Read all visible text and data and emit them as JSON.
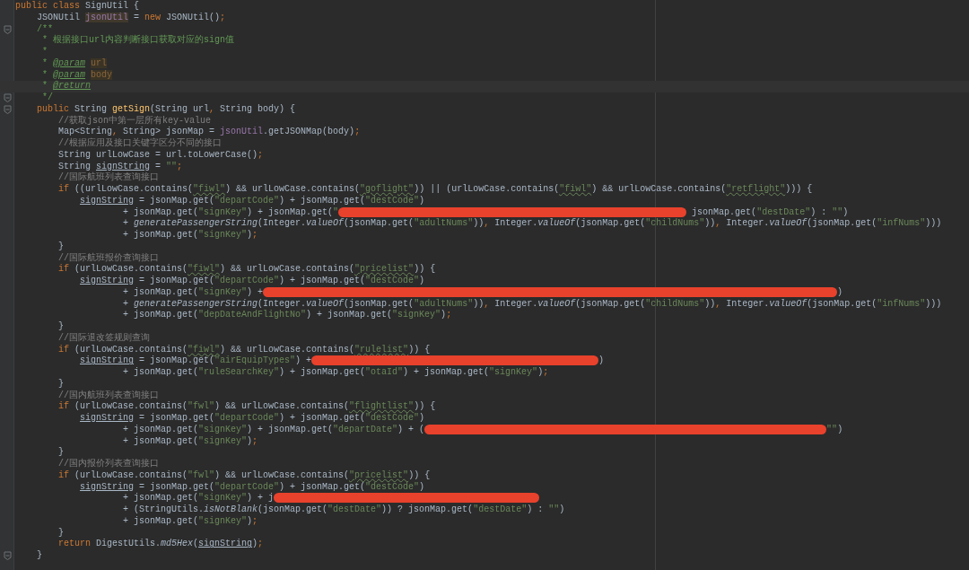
{
  "editor": {
    "lines": [
      {
        "current": false,
        "fold": false,
        "segments": [
          {
            "kind": "keyword",
            "text": "public class "
          },
          {
            "kind": "plain",
            "text": "SignUtil {"
          }
        ]
      },
      {
        "current": false,
        "fold": false,
        "segments": [
          {
            "kind": "plain",
            "text": "    JSONUtil "
          },
          {
            "kind": "usage",
            "text": "jsonUtil"
          },
          {
            "kind": "plain",
            "text": " = "
          },
          {
            "kind": "keyword",
            "text": "new "
          },
          {
            "kind": "plain",
            "text": "JSONUtil()"
          },
          {
            "kind": "keyword",
            "text": ";"
          }
        ]
      },
      {
        "current": false,
        "fold": true,
        "segments": [
          {
            "kind": "doc",
            "text": "    /**"
          }
        ]
      },
      {
        "current": false,
        "fold": false,
        "segments": [
          {
            "kind": "doc",
            "text": "     * 根据接口url内容判断接口获取对应的sign值"
          }
        ]
      },
      {
        "current": false,
        "fold": false,
        "segments": [
          {
            "kind": "doc",
            "text": "     *"
          }
        ]
      },
      {
        "current": false,
        "fold": false,
        "segments": [
          {
            "kind": "doc",
            "text": "     * "
          },
          {
            "kind": "doctag",
            "text": "@param"
          },
          {
            "kind": "docref",
            "text": " url"
          }
        ]
      },
      {
        "current": false,
        "fold": false,
        "segments": [
          {
            "kind": "doc",
            "text": "     * "
          },
          {
            "kind": "doctag",
            "text": "@param"
          },
          {
            "kind": "docref",
            "text": " body"
          }
        ]
      },
      {
        "current": true,
        "fold": false,
        "segments": [
          {
            "kind": "doc",
            "text": "     * "
          },
          {
            "kind": "doctag",
            "text": "@return"
          }
        ]
      },
      {
        "current": false,
        "fold": true,
        "segments": [
          {
            "kind": "doc",
            "text": "     */"
          }
        ]
      },
      {
        "current": false,
        "fold": true,
        "segments": [
          {
            "kind": "keyword",
            "text": "    public "
          },
          {
            "kind": "plain",
            "text": "String "
          },
          {
            "kind": "decl",
            "text": "getSign"
          },
          {
            "kind": "plain",
            "text": "(String url"
          },
          {
            "kind": "keyword",
            "text": ", "
          },
          {
            "kind": "plain",
            "text": "String body) {"
          }
        ]
      },
      {
        "current": false,
        "fold": false,
        "segments": [
          {
            "kind": "comment",
            "text": "        //获取json中第一层所有key-value"
          }
        ]
      },
      {
        "current": false,
        "fold": false,
        "segments": [
          {
            "kind": "plain",
            "text": "        Map<String"
          },
          {
            "kind": "keyword",
            "text": ", "
          },
          {
            "kind": "plain",
            "text": "String> jsonMap = "
          },
          {
            "kind": "field",
            "text": "jsonUtil"
          },
          {
            "kind": "plain",
            "text": ".getJSONMap(body)"
          },
          {
            "kind": "keyword",
            "text": ";"
          }
        ]
      },
      {
        "current": false,
        "fold": false,
        "segments": [
          {
            "kind": "comment",
            "text": "        //根据应用及接口关键字区分不同的接口"
          }
        ]
      },
      {
        "current": false,
        "fold": false,
        "segments": [
          {
            "kind": "plain",
            "text": "        String urlLowCase = url.toLowerCase()"
          },
          {
            "kind": "keyword",
            "text": ";"
          }
        ]
      },
      {
        "current": false,
        "fold": false,
        "segments": [
          {
            "kind": "plain",
            "text": "        String "
          },
          {
            "kind": "reassigned",
            "text": "signString"
          },
          {
            "kind": "plain",
            "text": " = "
          },
          {
            "kind": "string",
            "text": "\"\""
          },
          {
            "kind": "keyword",
            "text": ";"
          }
        ]
      },
      {
        "current": false,
        "fold": false,
        "segments": [
          {
            "kind": "comment",
            "text": "        //国际航班列表查询接口"
          }
        ]
      },
      {
        "current": false,
        "fold": false,
        "segments": [
          {
            "kind": "keyword",
            "text": "        if "
          },
          {
            "kind": "plain",
            "text": "((urlLowCase.contains("
          },
          {
            "kind": "typo",
            "text": "\"fiwl\""
          },
          {
            "kind": "plain",
            "text": ") && urlLowCase.contains("
          },
          {
            "kind": "typo",
            "text": "\"goflight\""
          },
          {
            "kind": "plain",
            "text": ")) || (urlLowCase.contains("
          },
          {
            "kind": "typo",
            "text": "\"fiwl\""
          },
          {
            "kind": "plain",
            "text": ") && urlLowCase.contains("
          },
          {
            "kind": "typo",
            "text": "\"retflight\""
          },
          {
            "kind": "plain",
            "text": "))) {"
          }
        ]
      },
      {
        "current": false,
        "fold": false,
        "segments": [
          {
            "kind": "reassigned",
            "text": "            signString"
          },
          {
            "kind": "plain",
            "text": " = jsonMap.get("
          },
          {
            "kind": "string",
            "text": "\"departCode\""
          },
          {
            "kind": "plain",
            "text": ") + jsonMap.get("
          },
          {
            "kind": "string",
            "text": "\"destCode\""
          },
          {
            "kind": "plain",
            "text": ")"
          }
        ]
      },
      {
        "current": false,
        "fold": false,
        "segments": [
          {
            "kind": "plain",
            "text": "                    + jsonMap.get("
          },
          {
            "kind": "string",
            "text": "\"signKey\""
          },
          {
            "kind": "plain",
            "text": ") + jsonMap.get("
          },
          {
            "kind": "string",
            "text": "\""
          },
          {
            "kind": "redaction"
          },
          {
            "kind": "plain",
            "text": " jsonMap.get("
          },
          {
            "kind": "string",
            "text": "\"destDate\""
          },
          {
            "kind": "plain",
            "text": ") : "
          },
          {
            "kind": "string",
            "text": "\"\""
          },
          {
            "kind": "plain",
            "text": ")"
          }
        ]
      },
      {
        "current": false,
        "fold": false,
        "segments": [
          {
            "kind": "plain",
            "text": "                    + "
          },
          {
            "kind": "static",
            "text": "generatePassengerString"
          },
          {
            "kind": "plain",
            "text": "(Integer."
          },
          {
            "kind": "static",
            "text": "valueOf"
          },
          {
            "kind": "plain",
            "text": "(jsonMap.get("
          },
          {
            "kind": "string",
            "text": "\"adultNums\""
          },
          {
            "kind": "plain",
            "text": "))"
          },
          {
            "kind": "keyword",
            "text": ", "
          },
          {
            "kind": "plain",
            "text": "Integer."
          },
          {
            "kind": "static",
            "text": "valueOf"
          },
          {
            "kind": "plain",
            "text": "(jsonMap.get("
          },
          {
            "kind": "string",
            "text": "\"childNums\""
          },
          {
            "kind": "plain",
            "text": "))"
          },
          {
            "kind": "keyword",
            "text": ", "
          },
          {
            "kind": "plain",
            "text": "Integer."
          },
          {
            "kind": "static",
            "text": "valueOf"
          },
          {
            "kind": "plain",
            "text": "(jsonMap.get("
          },
          {
            "kind": "string",
            "text": "\"infNums\""
          },
          {
            "kind": "plain",
            "text": ")))"
          }
        ]
      },
      {
        "current": false,
        "fold": false,
        "segments": [
          {
            "kind": "plain",
            "text": "                    + jsonMap.get("
          },
          {
            "kind": "string",
            "text": "\"signKey\""
          },
          {
            "kind": "plain",
            "text": ")"
          },
          {
            "kind": "keyword",
            "text": ";"
          }
        ]
      },
      {
        "current": false,
        "fold": false,
        "segments": [
          {
            "kind": "plain",
            "text": "        }"
          }
        ]
      },
      {
        "current": false,
        "fold": false,
        "segments": [
          {
            "kind": "comment",
            "text": "        //国际航班报价查询接口"
          }
        ]
      },
      {
        "current": false,
        "fold": false,
        "segments": [
          {
            "kind": "keyword",
            "text": "        if "
          },
          {
            "kind": "plain",
            "text": "(urlLowCase.contains("
          },
          {
            "kind": "typo",
            "text": "\"fiwl\""
          },
          {
            "kind": "plain",
            "text": ") && urlLowCase.contains("
          },
          {
            "kind": "typo",
            "text": "\"pricelist\""
          },
          {
            "kind": "plain",
            "text": ")) {"
          }
        ]
      },
      {
        "current": false,
        "fold": false,
        "segments": [
          {
            "kind": "reassigned",
            "text": "            signString"
          },
          {
            "kind": "plain",
            "text": " = jsonMap.get("
          },
          {
            "kind": "string",
            "text": "\"departCode\""
          },
          {
            "kind": "plain",
            "text": ") + jsonMap.get("
          },
          {
            "kind": "string",
            "text": "\"destCode\""
          },
          {
            "kind": "plain",
            "text": ")"
          }
        ]
      },
      {
        "current": false,
        "fold": false,
        "segments": [
          {
            "kind": "plain",
            "text": "                    + jsonMap.get("
          },
          {
            "kind": "string",
            "text": "\"signKey\""
          },
          {
            "kind": "plain",
            "text": ") +"
          },
          {
            "kind": "redaction"
          },
          {
            "kind": "plain",
            "text": ")"
          }
        ]
      },
      {
        "current": false,
        "fold": false,
        "segments": [
          {
            "kind": "plain",
            "text": "                    + "
          },
          {
            "kind": "static",
            "text": "generatePassengerString"
          },
          {
            "kind": "plain",
            "text": "(Integer."
          },
          {
            "kind": "static",
            "text": "valueOf"
          },
          {
            "kind": "plain",
            "text": "(jsonMap.get("
          },
          {
            "kind": "string",
            "text": "\"adultNums\""
          },
          {
            "kind": "plain",
            "text": "))"
          },
          {
            "kind": "keyword",
            "text": ", "
          },
          {
            "kind": "plain",
            "text": "Integer."
          },
          {
            "kind": "static",
            "text": "valueOf"
          },
          {
            "kind": "plain",
            "text": "(jsonMap.get("
          },
          {
            "kind": "string",
            "text": "\"childNums\""
          },
          {
            "kind": "plain",
            "text": "))"
          },
          {
            "kind": "keyword",
            "text": ", "
          },
          {
            "kind": "plain",
            "text": "Integer."
          },
          {
            "kind": "static",
            "text": "valueOf"
          },
          {
            "kind": "plain",
            "text": "(jsonMap.get("
          },
          {
            "kind": "string",
            "text": "\"infNums\""
          },
          {
            "kind": "plain",
            "text": ")))"
          }
        ]
      },
      {
        "current": false,
        "fold": false,
        "segments": [
          {
            "kind": "plain",
            "text": "                    + jsonMap.get("
          },
          {
            "kind": "string",
            "text": "\"depDateAndFlightNo\""
          },
          {
            "kind": "plain",
            "text": ") + jsonMap.get("
          },
          {
            "kind": "string",
            "text": "\"signKey\""
          },
          {
            "kind": "plain",
            "text": ")"
          },
          {
            "kind": "keyword",
            "text": ";"
          }
        ]
      },
      {
        "current": false,
        "fold": false,
        "segments": [
          {
            "kind": "plain",
            "text": "        }"
          }
        ]
      },
      {
        "current": false,
        "fold": false,
        "segments": [
          {
            "kind": "comment",
            "text": "        //国际退改签规则查询"
          }
        ]
      },
      {
        "current": false,
        "fold": false,
        "segments": [
          {
            "kind": "keyword",
            "text": "        if "
          },
          {
            "kind": "plain",
            "text": "(urlLowCase.contains("
          },
          {
            "kind": "typo",
            "text": "\"fiwl\""
          },
          {
            "kind": "plain",
            "text": ") && urlLowCase.contains("
          },
          {
            "kind": "typo",
            "text": "\"rulelist\""
          },
          {
            "kind": "plain",
            "text": ")) {"
          }
        ]
      },
      {
        "current": false,
        "fold": false,
        "segments": [
          {
            "kind": "reassigned",
            "text": "            signString"
          },
          {
            "kind": "plain",
            "text": " = jsonMap.get("
          },
          {
            "kind": "string",
            "text": "\"airEquipTypes\""
          },
          {
            "kind": "plain",
            "text": ") +"
          },
          {
            "kind": "redaction"
          },
          {
            "kind": "plain",
            "text": ")"
          }
        ]
      },
      {
        "current": false,
        "fold": false,
        "segments": [
          {
            "kind": "plain",
            "text": "                    + jsonMap.get("
          },
          {
            "kind": "string",
            "text": "\"ruleSearchKey\""
          },
          {
            "kind": "plain",
            "text": ") + jsonMap.get("
          },
          {
            "kind": "string",
            "text": "\"otaId\""
          },
          {
            "kind": "plain",
            "text": ") + jsonMap.get("
          },
          {
            "kind": "string",
            "text": "\"signKey\""
          },
          {
            "kind": "plain",
            "text": ")"
          },
          {
            "kind": "keyword",
            "text": ";"
          }
        ]
      },
      {
        "current": false,
        "fold": false,
        "segments": [
          {
            "kind": "plain",
            "text": "        }"
          }
        ]
      },
      {
        "current": false,
        "fold": false,
        "segments": [
          {
            "kind": "comment",
            "text": "        //国内航班列表查询接口"
          }
        ]
      },
      {
        "current": false,
        "fold": false,
        "segments": [
          {
            "kind": "keyword",
            "text": "        if "
          },
          {
            "kind": "plain",
            "text": "(urlLowCase.contains("
          },
          {
            "kind": "string",
            "text": "\"fwl\""
          },
          {
            "kind": "plain",
            "text": ") && urlLowCase.contains("
          },
          {
            "kind": "typo",
            "text": "\"flightlist\""
          },
          {
            "kind": "plain",
            "text": ")) {"
          }
        ]
      },
      {
        "current": false,
        "fold": false,
        "segments": [
          {
            "kind": "reassigned",
            "text": "            signString"
          },
          {
            "kind": "plain",
            "text": " = jsonMap.get("
          },
          {
            "kind": "string",
            "text": "\"departCode\""
          },
          {
            "kind": "plain",
            "text": ") + jsonMap.get("
          },
          {
            "kind": "string",
            "text": "\"destCode\""
          },
          {
            "kind": "plain",
            "text": ")"
          }
        ]
      },
      {
        "current": false,
        "fold": false,
        "segments": [
          {
            "kind": "plain",
            "text": "                    + jsonMap.get("
          },
          {
            "kind": "string",
            "text": "\"signKey\""
          },
          {
            "kind": "plain",
            "text": ") + jsonMap.get("
          },
          {
            "kind": "string",
            "text": "\"departDate\""
          },
          {
            "kind": "plain",
            "text": ") + ("
          },
          {
            "kind": "redaction"
          },
          {
            "kind": "string",
            "text": "\"\""
          },
          {
            "kind": "plain",
            "text": ")"
          }
        ]
      },
      {
        "current": false,
        "fold": false,
        "segments": [
          {
            "kind": "plain",
            "text": "                    + jsonMap.get("
          },
          {
            "kind": "string",
            "text": "\"signKey\""
          },
          {
            "kind": "plain",
            "text": ")"
          },
          {
            "kind": "keyword",
            "text": ";"
          }
        ]
      },
      {
        "current": false,
        "fold": false,
        "segments": [
          {
            "kind": "plain",
            "text": "        }"
          }
        ]
      },
      {
        "current": false,
        "fold": false,
        "segments": [
          {
            "kind": "comment",
            "text": "        //国内报价列表查询接口"
          }
        ]
      },
      {
        "current": false,
        "fold": false,
        "segments": [
          {
            "kind": "keyword",
            "text": "        if "
          },
          {
            "kind": "plain",
            "text": "(urlLowCase.contains("
          },
          {
            "kind": "string",
            "text": "\"fwl\""
          },
          {
            "kind": "plain",
            "text": ") && urlLowCase.contains("
          },
          {
            "kind": "typo",
            "text": "\"pricelist\""
          },
          {
            "kind": "plain",
            "text": ")) {"
          }
        ]
      },
      {
        "current": false,
        "fold": false,
        "segments": [
          {
            "kind": "reassigned",
            "text": "            signString"
          },
          {
            "kind": "plain",
            "text": " = jsonMap.get("
          },
          {
            "kind": "string",
            "text": "\"departCode\""
          },
          {
            "kind": "plain",
            "text": ") + jsonMap.get("
          },
          {
            "kind": "string",
            "text": "\"destCode\""
          },
          {
            "kind": "plain",
            "text": ")"
          }
        ]
      },
      {
        "current": false,
        "fold": false,
        "segments": [
          {
            "kind": "plain",
            "text": "                    + jsonMap.get("
          },
          {
            "kind": "string",
            "text": "\"signKey\""
          },
          {
            "kind": "plain",
            "text": ") + j"
          },
          {
            "kind": "redaction"
          }
        ]
      },
      {
        "current": false,
        "fold": false,
        "segments": [
          {
            "kind": "plain",
            "text": "                    + (StringUtils."
          },
          {
            "kind": "static",
            "text": "isNotBlank"
          },
          {
            "kind": "plain",
            "text": "(jsonMap.get("
          },
          {
            "kind": "string",
            "text": "\"destDate\""
          },
          {
            "kind": "plain",
            "text": ")) ? jsonMap.get("
          },
          {
            "kind": "string",
            "text": "\"destDate\""
          },
          {
            "kind": "plain",
            "text": ") : "
          },
          {
            "kind": "string",
            "text": "\"\""
          },
          {
            "kind": "plain",
            "text": ")"
          }
        ]
      },
      {
        "current": false,
        "fold": false,
        "segments": [
          {
            "kind": "plain",
            "text": "                    + jsonMap.get("
          },
          {
            "kind": "string",
            "text": "\"signKey\""
          },
          {
            "kind": "plain",
            "text": ")"
          },
          {
            "kind": "keyword",
            "text": ";"
          }
        ]
      },
      {
        "current": false,
        "fold": false,
        "segments": [
          {
            "kind": "plain",
            "text": "        }"
          }
        ]
      },
      {
        "current": false,
        "fold": false,
        "segments": [
          {
            "kind": "keyword",
            "text": "        return "
          },
          {
            "kind": "plain",
            "text": "DigestUtils."
          },
          {
            "kind": "static",
            "text": "md5Hex"
          },
          {
            "kind": "plain",
            "text": "("
          },
          {
            "kind": "reassigned",
            "text": "signString"
          },
          {
            "kind": "plain",
            "text": ")"
          },
          {
            "kind": "keyword",
            "text": ";"
          }
        ]
      },
      {
        "current": false,
        "fold": true,
        "segments": [
          {
            "kind": "plain",
            "text": "    }"
          }
        ]
      }
    ]
  }
}
